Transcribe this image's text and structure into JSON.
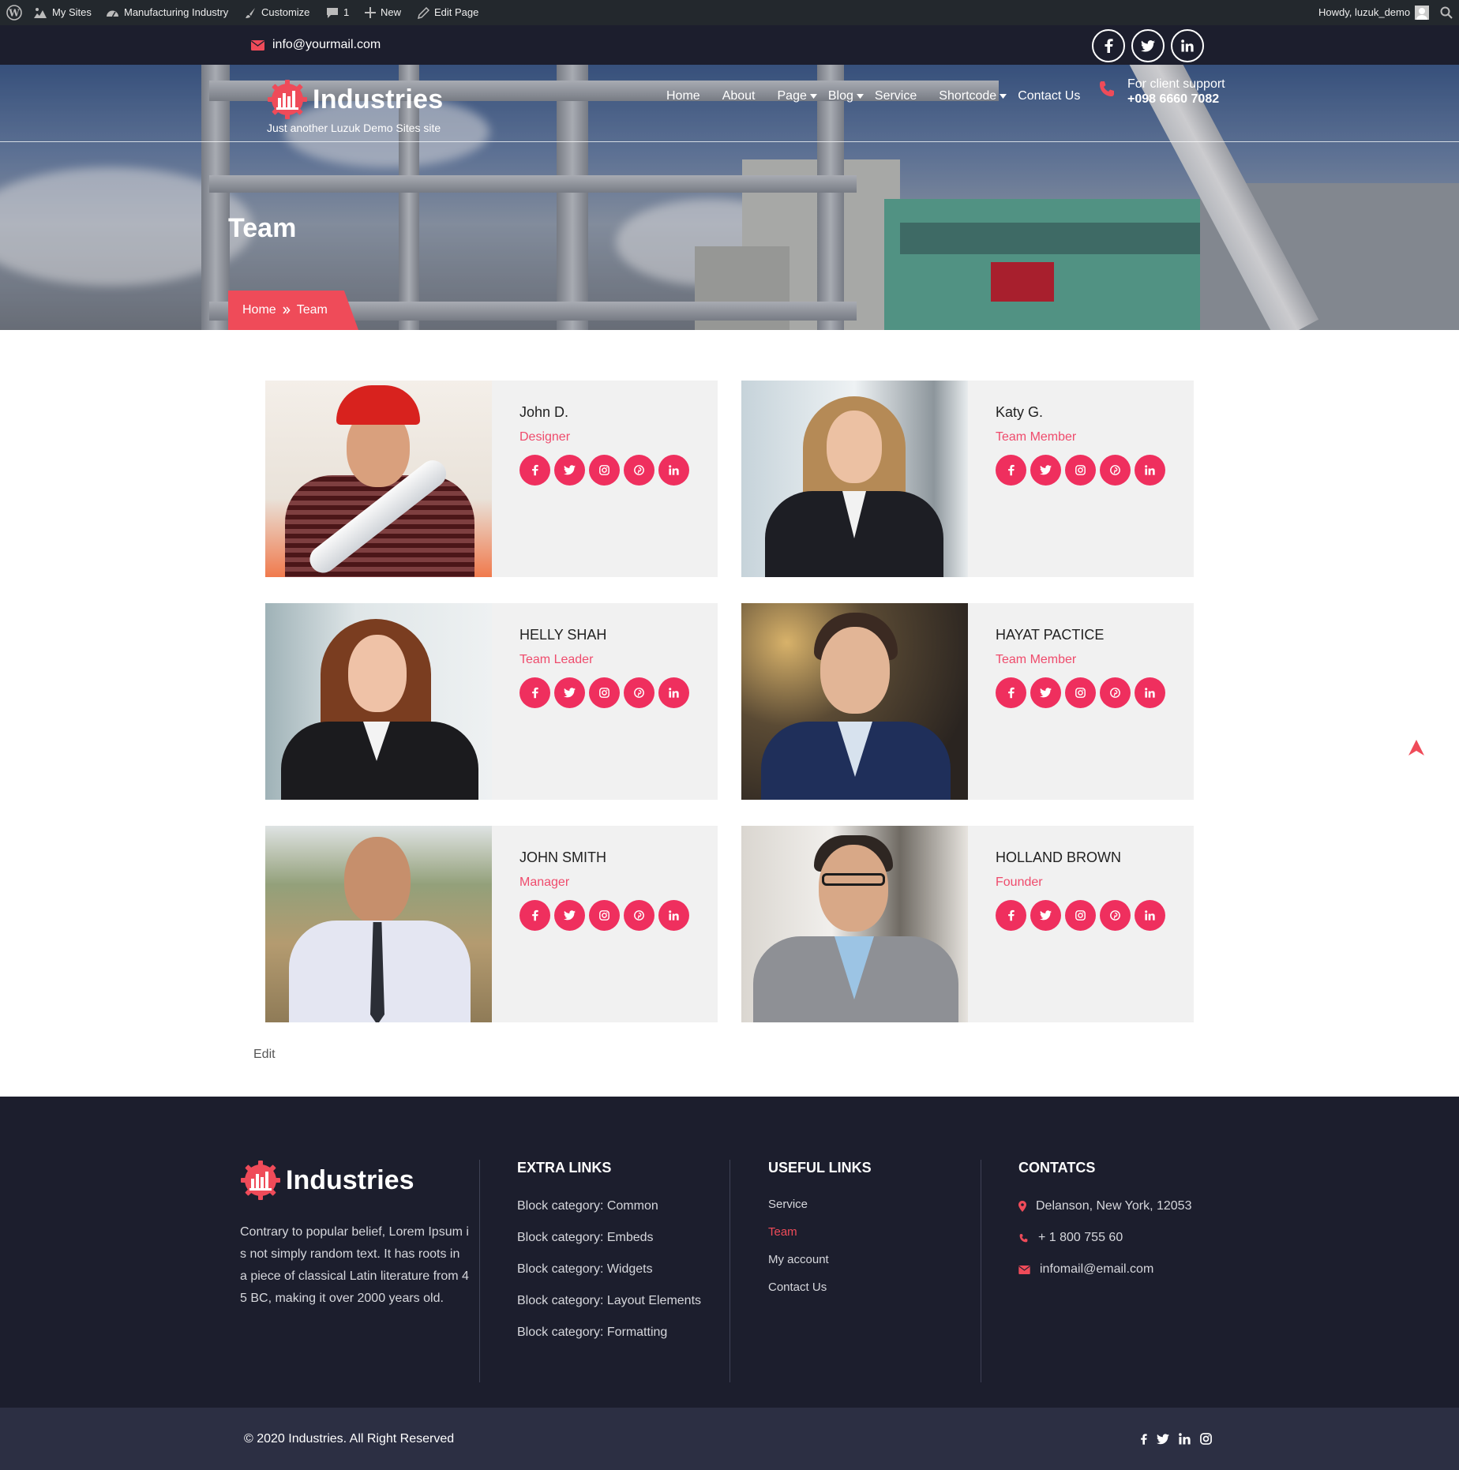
{
  "admin_bar": {
    "my_sites": "My Sites",
    "site_name": "Manufacturing Industry",
    "customize": "Customize",
    "comments_count": "1",
    "new": "New",
    "edit_page": "Edit Page",
    "howdy": "Howdy, luzuk_demo"
  },
  "topbar": {
    "email": "info@yourmail.com",
    "socials": [
      "facebook-icon",
      "twitter-icon",
      "linkedin-icon"
    ]
  },
  "header": {
    "logo_text": "Industries",
    "tagline": "Just another Luzuk Demo Sites site",
    "nav": [
      {
        "label": "Home",
        "dropdown": false
      },
      {
        "label": "About",
        "dropdown": false
      },
      {
        "label": "Page",
        "dropdown": true
      },
      {
        "label": "Blog",
        "dropdown": true
      },
      {
        "label": "Service",
        "dropdown": false
      },
      {
        "label": "Shortcode",
        "dropdown": true
      },
      {
        "label": "Contact Us",
        "dropdown": false
      }
    ],
    "support_label": "For client support",
    "support_phone": "+098 6660 7082"
  },
  "page": {
    "title": "Team",
    "breadcrumb": {
      "home": "Home",
      "current": "Team"
    },
    "edit_label": "Edit"
  },
  "team": [
    {
      "name": "John D.",
      "role": "Designer"
    },
    {
      "name": "Katy G.",
      "role": "Team Member"
    },
    {
      "name": "HELLY SHAH",
      "role": "Team Leader"
    },
    {
      "name": "HAYAT PACTICE",
      "role": "Team Member"
    },
    {
      "name": "JOHN SMITH",
      "role": "Manager"
    },
    {
      "name": "HOLLAND BROWN",
      "role": "Founder"
    }
  ],
  "member_socials": [
    "facebook-icon",
    "twitter-icon",
    "instagram-icon",
    "pinterest-icon",
    "linkedin-icon"
  ],
  "footer": {
    "logo_text": "Industries",
    "about": "Contrary to popular belief, Lorem Ipsum i s not simply random text. It has roots in a piece of classical Latin literature from 4 5 BC, making it over 2000 years old.",
    "extra_links_title": "EXTRA LINKS",
    "extra_links": [
      "Block category: Common",
      "Block category: Embeds",
      "Block category: Widgets",
      "Block category: Layout Elements",
      "Block category: Formatting"
    ],
    "useful_links_title": "USEFUL LINKS",
    "useful_links": [
      "Service",
      "Team",
      "My account",
      "Contact Us"
    ],
    "contacts_title": "CONTATCS",
    "address": "Delanson, New York, 12053",
    "phone": "+ 1 800 755 60",
    "email": "infomail@email.com",
    "copyright": "© 2020 Industries. All Right Reserved",
    "socials": [
      "facebook-icon",
      "twitter-icon",
      "linkedin-icon",
      "instagram-icon"
    ]
  },
  "colors": {
    "accent": "#ef2f5e",
    "breadcrumb": "#ef4b59",
    "dark_navy": "#1c1e2d",
    "admin_bar": "#23282d"
  }
}
